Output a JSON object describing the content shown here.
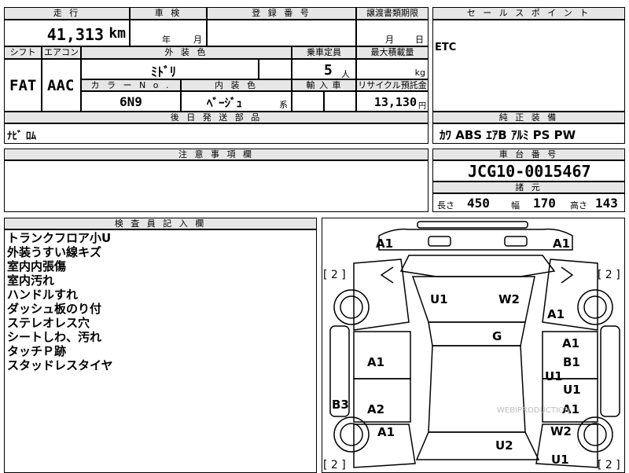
{
  "headers": {
    "mileage": "走 行",
    "inspection": "車 検",
    "registration": "登 録 番 号",
    "transfer_deadline": "譲渡書類期限",
    "sales_point": "セ ー ル ス ポ イ ン ト",
    "shift": "シフト",
    "aircon": "エアコン",
    "exterior_color": "外 装 色",
    "capacity": "乗車定員",
    "max_load": "最大積載量",
    "color_no": "カ ラ ー N o .",
    "interior_color": "内 装 色",
    "import": "輸 入 車",
    "recycle": "リサイクル預託金",
    "later_parts": "後 日 発 送 部 品",
    "factory_equipment": "純 正 装 備",
    "caution": "注 意 事 項 欄",
    "chassis_no": "車 台 番 号",
    "specs": "諸 元",
    "inspector_notes": "検 査 員 記 入 欄"
  },
  "values": {
    "mileage": "41,313",
    "mileage_unit": "km",
    "year_label": "年",
    "month_label": "月",
    "month_label2": "月",
    "day_label": "日",
    "shift": "FAT",
    "aircon": "AAC",
    "exterior_color": "ﾐﾄﾞﾘ",
    "capacity": "5",
    "capacity_unit": "人",
    "load_unit": "kg",
    "color_no": "6N9",
    "interior_color": "ﾍﾞｰｼﾞｭ",
    "interior_suffix": "系",
    "recycle": "13,130",
    "recycle_unit": "円",
    "sales_point": "ETC",
    "later_parts": "ﾅﾋﾞ ﾛﾑ",
    "factory_equipment": "ｶﾜ ABS ｴｱB ｱﾙﾐ PS PW",
    "chassis_no": "JCG10-0015467"
  },
  "specs": {
    "length_label": "長さ",
    "length": "450",
    "width_label": "幅",
    "width": "170",
    "height_label": "高さ",
    "height": "143"
  },
  "inspector_notes": [
    "トランクフロア小U",
    "外装うすい線キズ",
    "室内内張傷",
    "室内汚れ",
    "ハンドルすれ",
    "ダッシュ板のり付",
    "ステレオレス穴",
    "シートしわ、汚れ",
    "タッチＰ跡",
    "スタッドレスタイヤ"
  ],
  "damage_marks": {
    "front_left": "A1",
    "front_right": "A1",
    "bracket_fl": "[ 2 ]",
    "bracket_fr": "[ 2 ]",
    "bracket_rl": "[ 2 ]",
    "bracket_rr": "[ 2 ]",
    "windshield_left": "U1",
    "windshield_right": "W2",
    "right_fender": "A1",
    "roof": "G",
    "left_front_door": "A1",
    "right_front_door_1": "A1",
    "right_front_door_2": "B1",
    "right_front_door_3": "U1",
    "right_rear_door_1": "U1",
    "right_rear_door_2": "A1",
    "left_rocker": "B3",
    "left_rear_door": "A2",
    "left_rear_quarter": "A1",
    "rear_glass": "U2",
    "right_rear_quarter": "W2",
    "right_rear_bottom": "U1"
  },
  "watermark": "WEBIPRODUCTION"
}
